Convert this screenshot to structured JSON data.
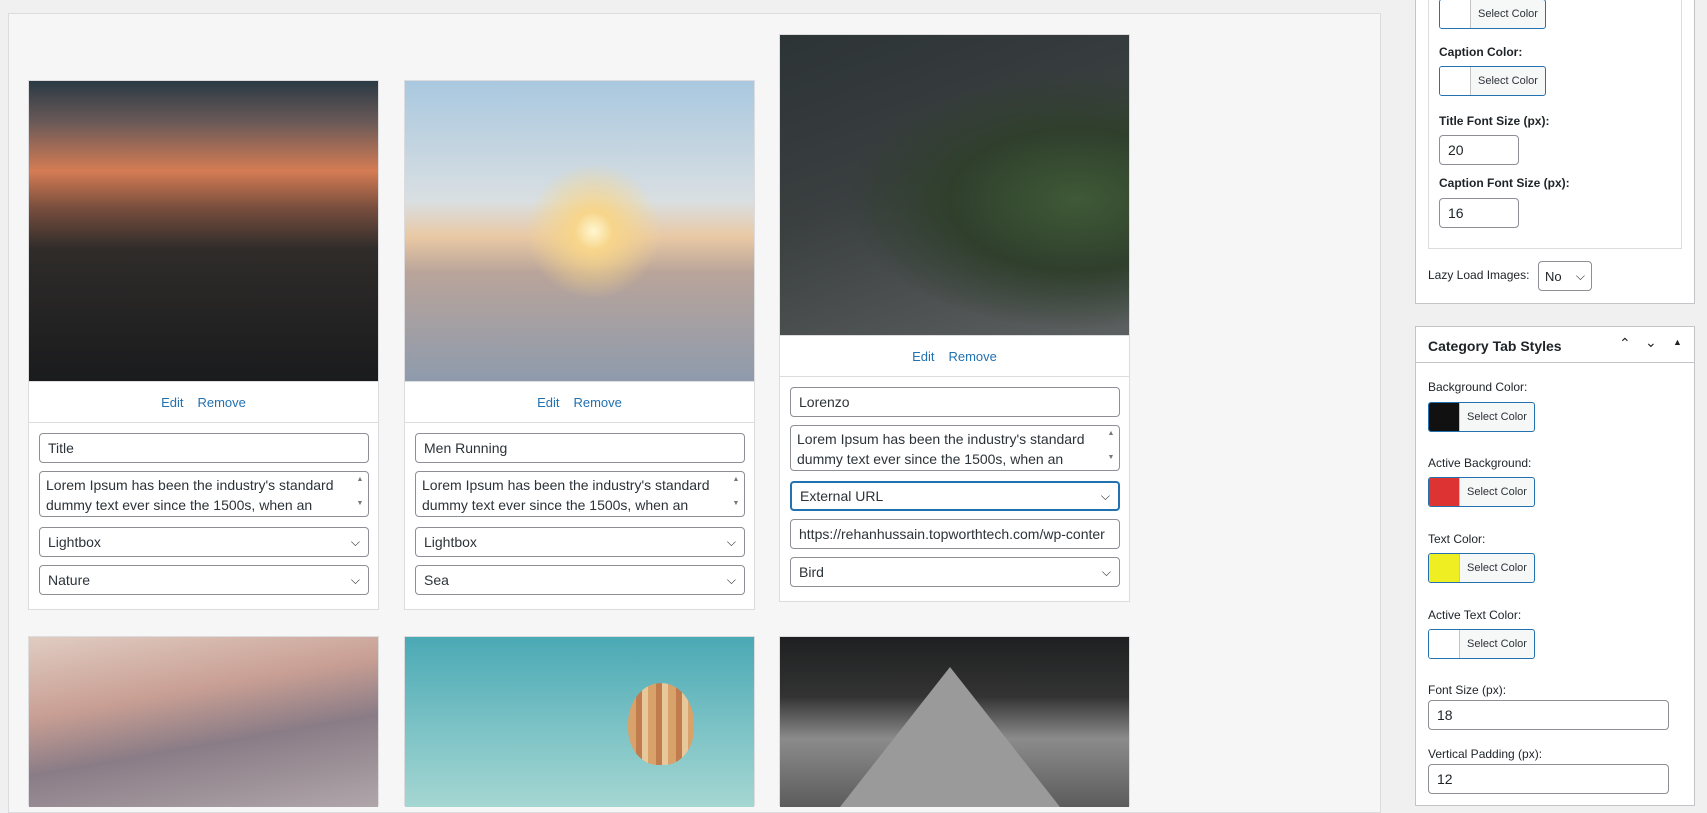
{
  "gallery": {
    "items": [
      {
        "edit": "Edit",
        "remove": "Remove",
        "title": "Title",
        "caption": "Lorem Ipsum has been the industry's standard dummy text ever since the 1500s, when an",
        "link_type": "Lightbox",
        "category": "Nature"
      },
      {
        "edit": "Edit",
        "remove": "Remove",
        "title": "Men Running",
        "caption": "Lorem Ipsum has been the industry's standard dummy text ever since the 1500s, when an",
        "link_type": "Lightbox",
        "category": "Sea"
      },
      {
        "edit": "Edit",
        "remove": "Remove",
        "title": "Lorenzo",
        "caption": "Lorem Ipsum has been the industry's standard dummy text ever since the 1500s, when an",
        "link_type": "External URL",
        "url": "https://rehanhussain.topworthtech.com/wp-conter",
        "category": "Bird"
      }
    ]
  },
  "sidebar": {
    "top_panel": {
      "select_color": "Select Color",
      "caption_color_label": "Caption Color:",
      "title_font_size_label": "Title Font Size (px):",
      "title_font_size": "20",
      "caption_font_size_label": "Caption Font Size (px):",
      "caption_font_size": "16",
      "lazy_load_label": "Lazy Load Images:",
      "lazy_load_value": "No"
    },
    "category_panel": {
      "title": "Category Tab Styles",
      "background_color_label": "Background Color:",
      "background_color": "#111111",
      "active_background_label": "Active Background:",
      "active_background": "#dd3333",
      "text_color_label": "Text Color:",
      "text_color": "#eeee22",
      "active_text_color_label": "Active Text Color:",
      "active_text_color": "#ffffff",
      "select_color": "Select Color",
      "font_size_label": "Font Size (px):",
      "font_size": "18",
      "vertical_padding_label": "Vertical Padding (px):",
      "vertical_padding": "12"
    }
  }
}
